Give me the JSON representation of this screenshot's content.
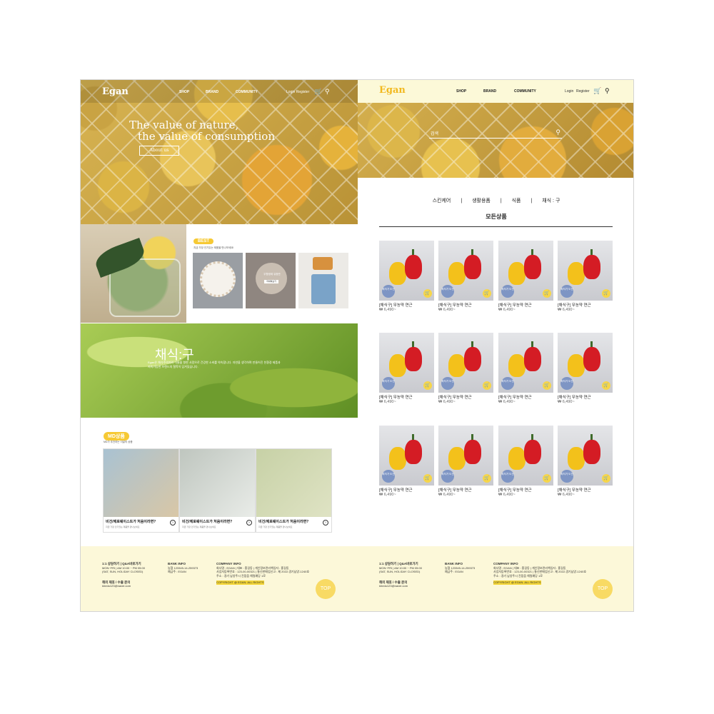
{
  "left": {
    "logo": "Egan",
    "nav": [
      "SHOP",
      "BRAND",
      "COMMUNITY"
    ],
    "util": "Login  Register",
    "hero_title_1": "The value of nature,",
    "hero_title_2": "the value of consumption",
    "about_button": "About us",
    "best_pill": "BEST",
    "best_sub": "지금 가장 인기있는 제품을 만나보세요!",
    "best_overlay": "무항생제 유정란",
    "best_btn": "자세히보기",
    "chaesik_title": "채식:구",
    "chaesik_desc": "Egan은 채식주의자와 식물을 향한 사랑으로 건강한 소비를 약속합니다. 자연을 생각하며 만들어진 친환경 제품과 지속가능한 브랜드의 철학이 담겨있습니다.",
    "md_pill": "MD상품",
    "md_sub": "MD가 추천하는 이달의 상품",
    "md_cards": [
      {
        "title": "비건/제로웨이스트가 처음이라면?",
        "sub": "지금 가장 인기있는 제품을 만나보세요"
      },
      {
        "title": "비건/제로웨이스트가 처음이라면?",
        "sub": "지금 가장 인기있는 제품을 만나보세요"
      },
      {
        "title": "비건/제로웨이스트가 처음이라면?",
        "sub": "지금 가장 인기있는 제품을 만나보세요"
      }
    ]
  },
  "right": {
    "logo": "Egan",
    "nav": [
      "SHOP",
      "BRAND",
      "COMMUNITY"
    ],
    "login": "Login",
    "register": "Register",
    "search_placeholder": "검색",
    "categories": [
      "스킨케어",
      "|",
      "생활용품",
      "|",
      "식품",
      "|",
      "채식 : 구"
    ],
    "all_products": "모든상품",
    "product": {
      "badge": "최저가 도전",
      "name": "[채식구] 무농약 연근",
      "price": "₩ 6,490~"
    }
  },
  "footer": {
    "cs_title": "1:1 상담하기",
    "cs_link": "Q&A바로가기",
    "hours1": "MON~FRI | AM 10:00 ~ PM 05:00",
    "hours2": "(SAT, SUN, HOLIDAY CLOSED)",
    "partner": "해외 제휴 / 수출 문의",
    "email": "khedu123@naver.com",
    "bank_title": "BANK INFO",
    "bank1": "농협 123345-14-259373",
    "bank2": "예금주 : EGAN",
    "company_title": "COMPANY INFO",
    "company1": "회사명 : EGAN | 대표 : 홍길동 | 개인정보관리책임자 : 홍길동",
    "company2": "사업자등록번호 : 123-00-00321 | 통신판매업신고 : 제 2022-경기남양-1240호",
    "company3": "주소 : 경기 남양주시 진접읍 해밀예당 1로",
    "copyright": "COPYRIGHT @ EGAN. ALL RIGHTS",
    "top": "TOP"
  },
  "colors": {
    "accent": "#f6c934",
    "header_bg": "#fcf9d8",
    "footer_bg": "#fcf8d9",
    "badge": "#7e95c4"
  }
}
